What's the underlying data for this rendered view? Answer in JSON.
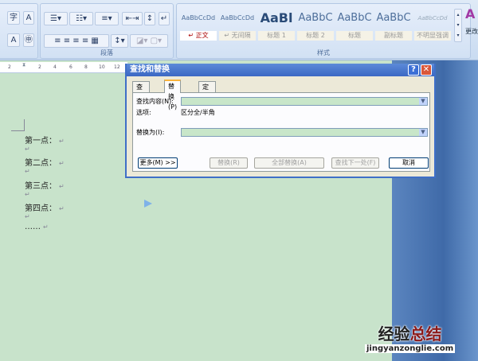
{
  "ribbon": {
    "paragraph_group_label": "段落",
    "styles_group_label": "样式",
    "change_styles_label": "更改",
    "styles": [
      {
        "preview": "AaBbCcDd",
        "name": "↵ 正文"
      },
      {
        "preview": "AaBbCcDd",
        "name": "↵ 无间隔"
      },
      {
        "preview": "AaBl",
        "name": "标题 1"
      },
      {
        "preview": "AaBbC",
        "name": "标题 2"
      },
      {
        "preview": "AaBbC",
        "name": "标题"
      },
      {
        "preview": "AaBbC",
        "name": "副标题"
      },
      {
        "preview": "AaBbCcDd",
        "name": "不明显强调"
      }
    ]
  },
  "ruler": {
    "ticks": [
      "2",
      "2",
      "4",
      "6",
      "8",
      "10",
      "12"
    ]
  },
  "document": {
    "lines": [
      "第一点：",
      "↵",
      "第二点：",
      "↵",
      "第三点：",
      "↵",
      "第四点：",
      "↵",
      "……"
    ]
  },
  "dialog": {
    "title": "查找和替换",
    "help": "?",
    "close": "✕",
    "tabs": [
      "查找(D)",
      "替换(P)",
      "定位(G)"
    ],
    "find_label": "查找内容(N):",
    "find_value": "",
    "options_label": "选项:",
    "options_value": "区分全/半角",
    "replace_label": "替换为(I):",
    "replace_value": "",
    "buttons": {
      "more": "更多(M) >>",
      "replace": "替换(R)",
      "replace_all": "全部替换(A)",
      "find_next": "查找下一处(F)",
      "cancel": "取消"
    }
  },
  "watermark": {
    "text_a": "经验",
    "text_b": "总结",
    "url": "jingyanzonglie.com"
  }
}
